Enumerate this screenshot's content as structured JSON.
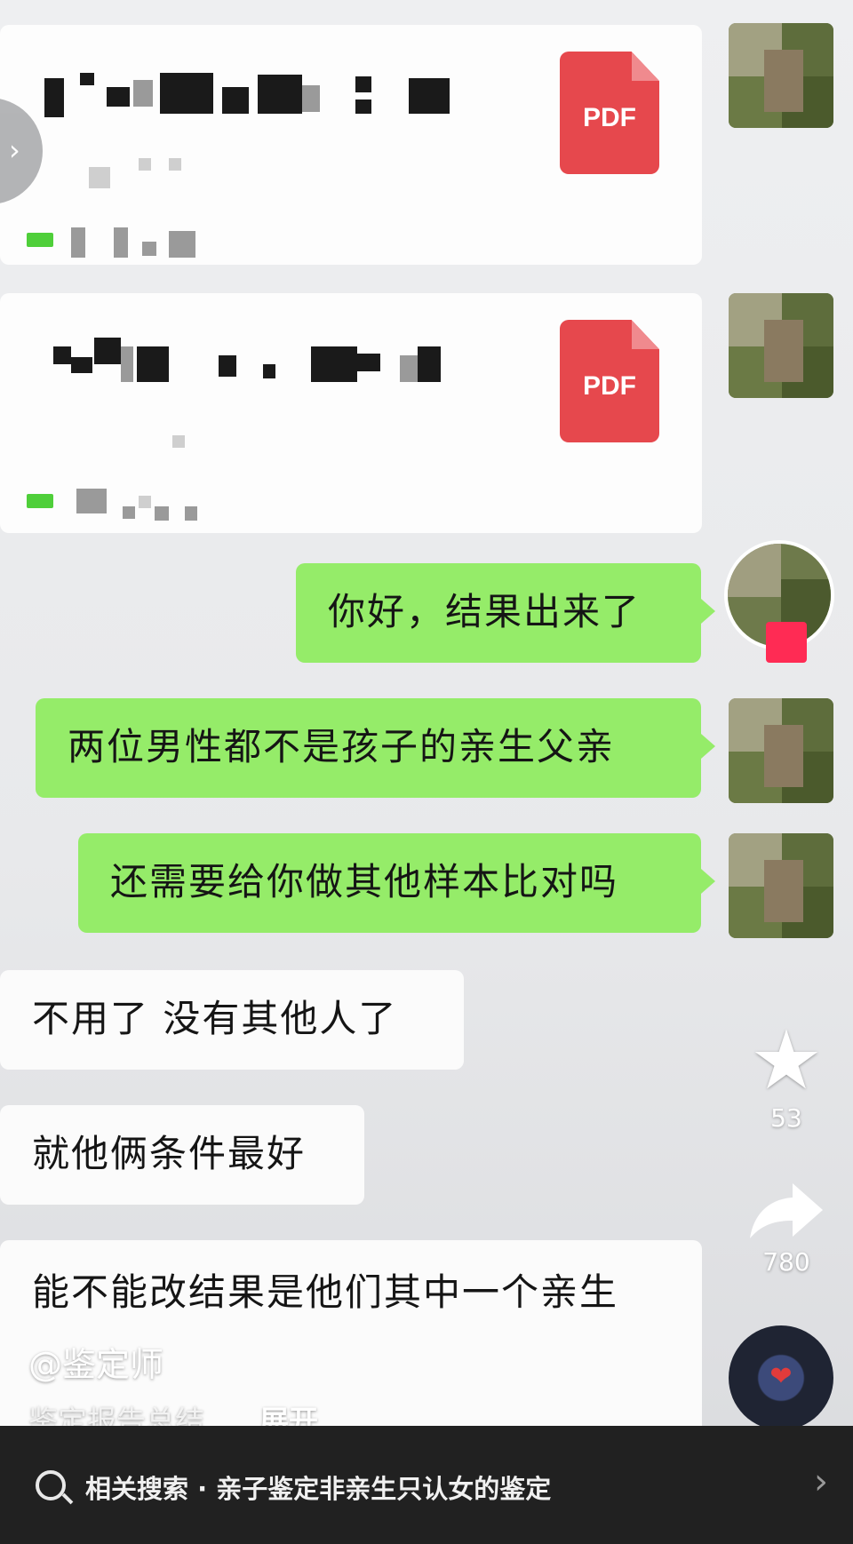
{
  "file_messages": [
    {
      "file_type": "PDF"
    },
    {
      "file_type": "PDF"
    }
  ],
  "messages": [
    {
      "side": "right",
      "text": "你好，结果出来了"
    },
    {
      "side": "right",
      "text": "两位男性都不是孩子的亲生父亲"
    },
    {
      "side": "right",
      "text": "还需要给你做其他样本比对吗"
    },
    {
      "side": "left",
      "text": "不用了 没有其他人了"
    },
    {
      "side": "left",
      "text": "就他俩条件最好"
    },
    {
      "side": "left",
      "text": "能不能改结果是他们其中一个亲生"
    }
  ],
  "sidebar": {
    "favorite_count": "53",
    "share_count": "780",
    "favorite_icon": "star-icon",
    "share_icon": "share-arrow-icon"
  },
  "video_info": {
    "author": "@鉴定师",
    "description": "鉴定报告总结 ...",
    "expand_label": "展开"
  },
  "related_search": {
    "text": "相关搜索 · 亲子鉴定非亲生只认女的鉴定"
  },
  "colors": {
    "green_bubble": "#95ec69",
    "pdf_red": "#e6484d",
    "bottom_bar": "#212121",
    "follow_red": "#ff2b54"
  }
}
